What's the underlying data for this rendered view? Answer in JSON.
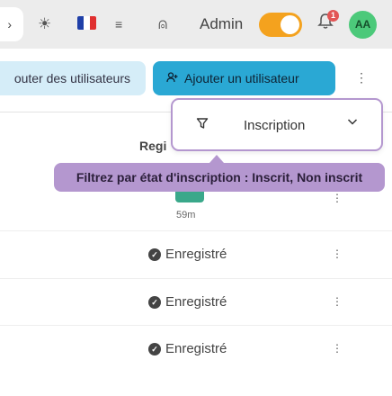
{
  "header": {
    "back_icon": "chevron-right-icon",
    "back_glyph": "›",
    "theme_icon": "sun-icon",
    "theme_glyph": "☀",
    "language_icon": "french-flag-icon",
    "flag_colors": [
      "#1f3fa8",
      "#ffffff",
      "#e03030"
    ],
    "menu_icon": "lines-icon",
    "menu_glyph": "≡",
    "user_icon": "user-icon",
    "user_glyph": "⍝",
    "admin_label": "Admin",
    "admin_toggle_on": true,
    "notifications_icon": "bell-icon",
    "notifications_glyph": "🔔",
    "notification_count": "1",
    "avatar_initials": "AA"
  },
  "actions": {
    "add_users_label": "outer des utilisateurs",
    "add_user_label": "Ajouter un utilisateur",
    "add_user_icon": "user-plus-icon",
    "add_user_glyph": "👤+",
    "more_glyph": "⋮"
  },
  "filter": {
    "icon": "funnel-icon",
    "glyph": "⛛",
    "label": "Inscription",
    "chevron_icon": "chevron-down-icon"
  },
  "tooltip": {
    "text": "Filtrez par état d'inscription : Inscrit, Non inscrit"
  },
  "table": {
    "column_header": "Regi",
    "first_row_time": "59m",
    "rows": [
      {
        "status": "Enregistré"
      },
      {
        "status": "Enregistré"
      },
      {
        "status": "Enregistré"
      }
    ],
    "row_more_glyph": "⋮",
    "status_check_glyph": "✓"
  },
  "colors": {
    "accent": "#2aa8d4",
    "accent_light": "#d5edf8",
    "toggle": "#f4a21e",
    "tooltip": "#b497cf",
    "avatar": "#4cc97a",
    "badge": "#e25555"
  }
}
